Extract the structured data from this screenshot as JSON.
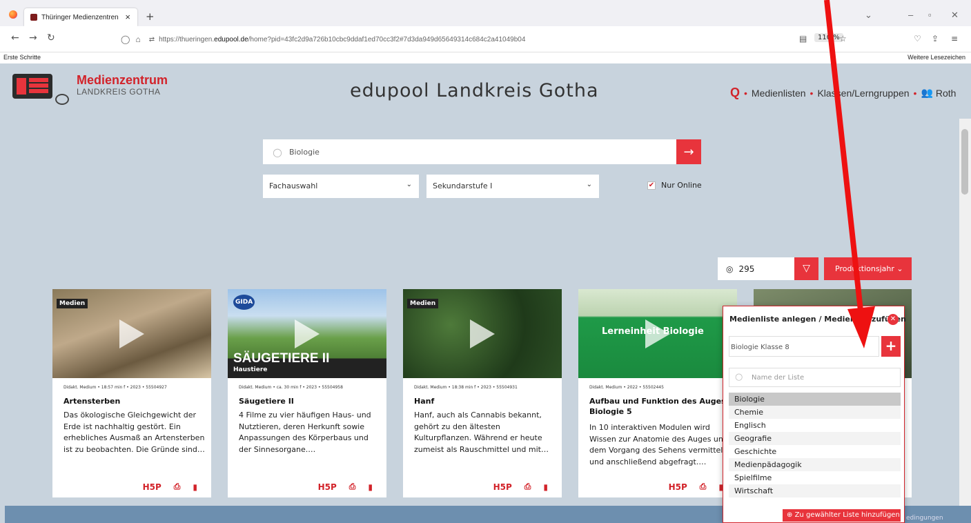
{
  "browser": {
    "tab_title": "Thüringer Medienzentren",
    "url_prefix": "https://thueringen.",
    "url_domain": "edupool.de",
    "url_path": "/home?pid=43fc2d9a726b10cbc9ddaf1ed70cc3f2#7d3da949d65649314c684c2a41049b04",
    "zoom": "110 %",
    "bookmark_left": "Erste Schritte",
    "bookmark_right": "Weitere Lesezeichen"
  },
  "header": {
    "brand_line1": "Medienzentrum",
    "brand_line2": "LANDKREIS GOTHA",
    "site_title": "edupool Landkreis Gotha",
    "nav": {
      "medienlisten": "Medienlisten",
      "klassen": "Klassen/Lerngruppen",
      "user": "Roth"
    }
  },
  "search": {
    "query": "Biologie",
    "fach": "Fachauswahl",
    "stufe": "Sekundarstufe I",
    "nur_online": "Nur Online"
  },
  "results": {
    "count": "295",
    "sort_label": "Produktionsjahr"
  },
  "cards": [
    {
      "meta": "Didakt. Medium • 18:57 min f • 2023 • 55504927",
      "title": "Artensterben",
      "desc": "Das ökologische Gleichgewicht der Erde ist nachhaltig gestört. Ein erhebliches Ausmaß an Artensterben ist zu beobachten. Die Gründe sind…",
      "badge": "Medien"
    },
    {
      "meta": "Didakt. Medium • ca. 30 min f • 2023 • 55504958",
      "title": "Säugetiere II",
      "desc": "4 Filme zu vier häufigen Haus- und Nutztieren, deren Herkunft sowie Anpassungen des Körperbaus und der Sinnesorgane.…",
      "thumb_title": "SÄUGETIERE II",
      "thumb_sub": "Haustiere",
      "badge": "GIDA"
    },
    {
      "meta": "Didakt. Medium • 18:38 min f • 2023 • 55504931",
      "title": "Hanf",
      "desc": "Hanf, auch als Cannabis bekannt, gehört zu den ältesten Kulturpflanzen. Während er heute zumeist als Rauschmittel und mit…",
      "badge": "Medien"
    },
    {
      "meta": "Didakt. Medium • 2022 • 55502445",
      "title": "Aufbau und Funktion des Auges: Biologie 5",
      "desc": "In 10 interaktiven Modulen wird Wissen zur Anatomie des Auges und dem Vorgang des Sehens vermittelt und anschließend abgefragt.…",
      "thumb_title": "Lerneinheit Biologie"
    }
  ],
  "card_icons": {
    "hp": "H5P"
  },
  "popup": {
    "title": "Medienliste anlegen / Medien hinzufügen",
    "selected_list": "Biologie Klasse 8",
    "search_placeholder": "Name der Liste",
    "items": [
      "Biologie",
      "Chemie",
      "Englisch",
      "Geografie",
      "Geschichte",
      "Medienpädagogik",
      "Spielfilme",
      "Wirtschaft"
    ],
    "submit": "Zu gewählter Liste hinzufügen"
  },
  "footer": {
    "text": "edingungen"
  },
  "colors": {
    "accent": "#e8343c",
    "brand_red": "#d2232a",
    "header_bg": "#c8d3dd",
    "footer_bg": "#6d8faf"
  }
}
